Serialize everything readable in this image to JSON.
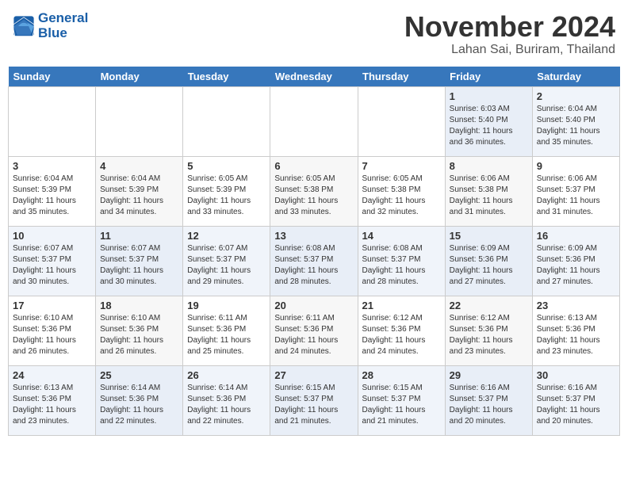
{
  "logo": {
    "general": "General",
    "blue": "Blue"
  },
  "header": {
    "month": "November 2024",
    "location": "Lahan Sai, Buriram, Thailand"
  },
  "days_of_week": [
    "Sunday",
    "Monday",
    "Tuesday",
    "Wednesday",
    "Thursday",
    "Friday",
    "Saturday"
  ],
  "weeks": [
    {
      "cells": [
        {
          "day": "",
          "info": ""
        },
        {
          "day": "",
          "info": ""
        },
        {
          "day": "",
          "info": ""
        },
        {
          "day": "",
          "info": ""
        },
        {
          "day": "",
          "info": ""
        },
        {
          "day": "1",
          "info": "Sunrise: 6:03 AM\nSunset: 5:40 PM\nDaylight: 11 hours and 36 minutes."
        },
        {
          "day": "2",
          "info": "Sunrise: 6:04 AM\nSunset: 5:40 PM\nDaylight: 11 hours and 35 minutes."
        }
      ]
    },
    {
      "cells": [
        {
          "day": "3",
          "info": "Sunrise: 6:04 AM\nSunset: 5:39 PM\nDaylight: 11 hours and 35 minutes."
        },
        {
          "day": "4",
          "info": "Sunrise: 6:04 AM\nSunset: 5:39 PM\nDaylight: 11 hours and 34 minutes."
        },
        {
          "day": "5",
          "info": "Sunrise: 6:05 AM\nSunset: 5:39 PM\nDaylight: 11 hours and 33 minutes."
        },
        {
          "day": "6",
          "info": "Sunrise: 6:05 AM\nSunset: 5:38 PM\nDaylight: 11 hours and 33 minutes."
        },
        {
          "day": "7",
          "info": "Sunrise: 6:05 AM\nSunset: 5:38 PM\nDaylight: 11 hours and 32 minutes."
        },
        {
          "day": "8",
          "info": "Sunrise: 6:06 AM\nSunset: 5:38 PM\nDaylight: 11 hours and 31 minutes."
        },
        {
          "day": "9",
          "info": "Sunrise: 6:06 AM\nSunset: 5:37 PM\nDaylight: 11 hours and 31 minutes."
        }
      ]
    },
    {
      "cells": [
        {
          "day": "10",
          "info": "Sunrise: 6:07 AM\nSunset: 5:37 PM\nDaylight: 11 hours and 30 minutes."
        },
        {
          "day": "11",
          "info": "Sunrise: 6:07 AM\nSunset: 5:37 PM\nDaylight: 11 hours and 30 minutes."
        },
        {
          "day": "12",
          "info": "Sunrise: 6:07 AM\nSunset: 5:37 PM\nDaylight: 11 hours and 29 minutes."
        },
        {
          "day": "13",
          "info": "Sunrise: 6:08 AM\nSunset: 5:37 PM\nDaylight: 11 hours and 28 minutes."
        },
        {
          "day": "14",
          "info": "Sunrise: 6:08 AM\nSunset: 5:37 PM\nDaylight: 11 hours and 28 minutes."
        },
        {
          "day": "15",
          "info": "Sunrise: 6:09 AM\nSunset: 5:36 PM\nDaylight: 11 hours and 27 minutes."
        },
        {
          "day": "16",
          "info": "Sunrise: 6:09 AM\nSunset: 5:36 PM\nDaylight: 11 hours and 27 minutes."
        }
      ]
    },
    {
      "cells": [
        {
          "day": "17",
          "info": "Sunrise: 6:10 AM\nSunset: 5:36 PM\nDaylight: 11 hours and 26 minutes."
        },
        {
          "day": "18",
          "info": "Sunrise: 6:10 AM\nSunset: 5:36 PM\nDaylight: 11 hours and 26 minutes."
        },
        {
          "day": "19",
          "info": "Sunrise: 6:11 AM\nSunset: 5:36 PM\nDaylight: 11 hours and 25 minutes."
        },
        {
          "day": "20",
          "info": "Sunrise: 6:11 AM\nSunset: 5:36 PM\nDaylight: 11 hours and 24 minutes."
        },
        {
          "day": "21",
          "info": "Sunrise: 6:12 AM\nSunset: 5:36 PM\nDaylight: 11 hours and 24 minutes."
        },
        {
          "day": "22",
          "info": "Sunrise: 6:12 AM\nSunset: 5:36 PM\nDaylight: 11 hours and 23 minutes."
        },
        {
          "day": "23",
          "info": "Sunrise: 6:13 AM\nSunset: 5:36 PM\nDaylight: 11 hours and 23 minutes."
        }
      ]
    },
    {
      "cells": [
        {
          "day": "24",
          "info": "Sunrise: 6:13 AM\nSunset: 5:36 PM\nDaylight: 11 hours and 23 minutes."
        },
        {
          "day": "25",
          "info": "Sunrise: 6:14 AM\nSunset: 5:36 PM\nDaylight: 11 hours and 22 minutes."
        },
        {
          "day": "26",
          "info": "Sunrise: 6:14 AM\nSunset: 5:36 PM\nDaylight: 11 hours and 22 minutes."
        },
        {
          "day": "27",
          "info": "Sunrise: 6:15 AM\nSunset: 5:37 PM\nDaylight: 11 hours and 21 minutes."
        },
        {
          "day": "28",
          "info": "Sunrise: 6:15 AM\nSunset: 5:37 PM\nDaylight: 11 hours and 21 minutes."
        },
        {
          "day": "29",
          "info": "Sunrise: 6:16 AM\nSunset: 5:37 PM\nDaylight: 11 hours and 20 minutes."
        },
        {
          "day": "30",
          "info": "Sunrise: 6:16 AM\nSunset: 5:37 PM\nDaylight: 11 hours and 20 minutes."
        }
      ]
    }
  ]
}
